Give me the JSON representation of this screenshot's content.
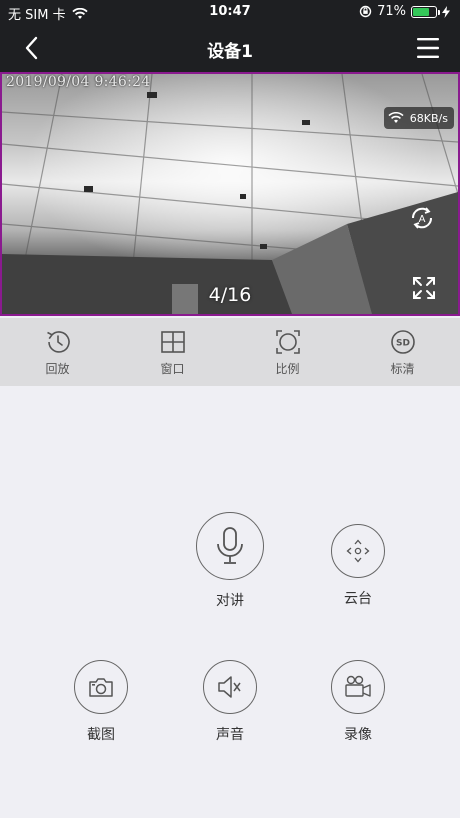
{
  "status_bar": {
    "carrier": "无 SIM 卡",
    "time": "10:47",
    "battery_percent": "71%",
    "battery_level": 0.71,
    "battery_color": "#34c759"
  },
  "nav": {
    "title": "设备1",
    "back_icon": "chevron-left-icon",
    "menu_icon": "hamburger-menu-icon"
  },
  "video": {
    "timestamp": "2019/09/04  9:46:24",
    "speed": "68KB/s",
    "page_counter": "4/16",
    "border_color": "#8a1a8f"
  },
  "toolbar": [
    {
      "label": "回放",
      "icon": "playback-history-icon"
    },
    {
      "label": "窗口",
      "icon": "window-grid-icon"
    },
    {
      "label": "比例",
      "icon": "aspect-ratio-icon"
    },
    {
      "label": "标清",
      "icon": "sd-quality-icon"
    }
  ],
  "controls": {
    "talk": {
      "label": "对讲",
      "icon": "microphone-icon"
    },
    "ptz": {
      "label": "云台",
      "icon": "ptz-directions-icon"
    },
    "screenshot": {
      "label": "截图",
      "icon": "camera-icon"
    },
    "sound": {
      "label": "声音",
      "icon": "speaker-muted-icon"
    },
    "record": {
      "label": "录像",
      "icon": "video-camera-icon"
    }
  }
}
